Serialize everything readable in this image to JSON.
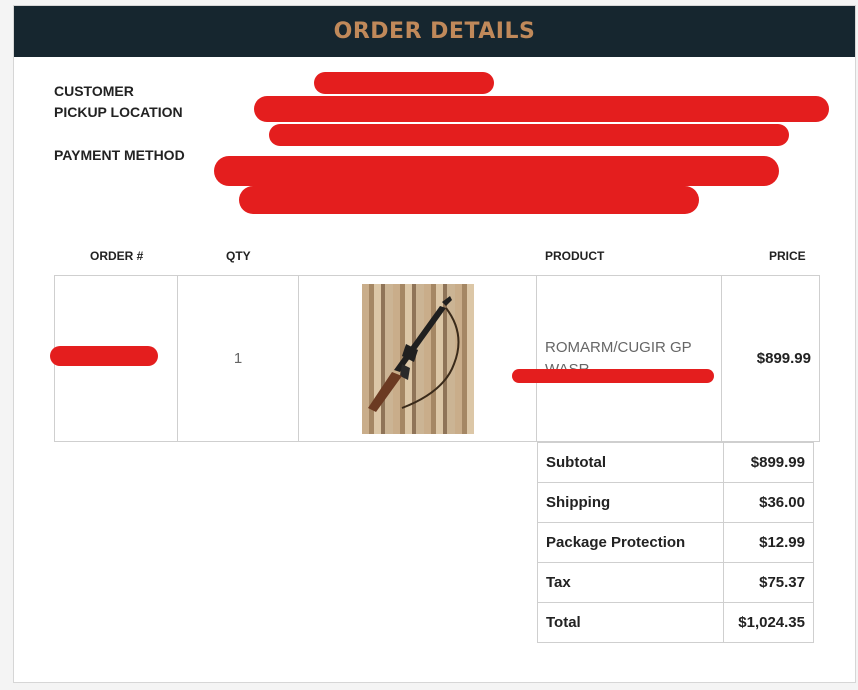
{
  "header": {
    "title": "ORDER DETAILS"
  },
  "info": {
    "customer_label": "CUSTOMER",
    "pickup_label": "PICKUP LOCATION",
    "payment_label": "PAYMENT METHOD"
  },
  "columns": {
    "order": "ORDER #",
    "qty": "QTY",
    "product": "PRODUCT",
    "price": "PRICE"
  },
  "item": {
    "qty": "1",
    "product_name": "ROMARM/CUGIR GP WASR",
    "price": "$899.99"
  },
  "totals": [
    {
      "label": "Subtotal",
      "value": "$899.99"
    },
    {
      "label": "Shipping",
      "value": "$36.00"
    },
    {
      "label": "Package Protection",
      "value": "$12.99"
    },
    {
      "label": "Tax",
      "value": "$75.37"
    },
    {
      "label": "Total",
      "value": "$1,024.35"
    }
  ],
  "colors": {
    "header_bg": "#16262f",
    "header_text": "#c0895a",
    "redaction": "#e41e1e"
  }
}
